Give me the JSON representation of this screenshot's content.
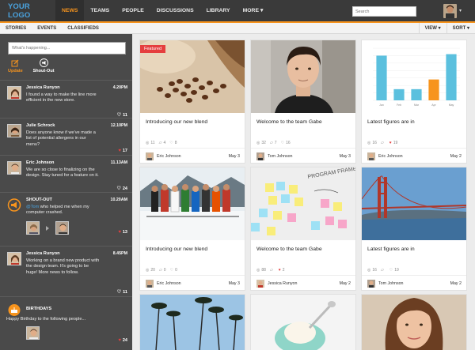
{
  "nav": {
    "logo": "YOUR LOGO",
    "items": [
      {
        "label": "NEWS",
        "active": true
      },
      {
        "label": "TEAMS"
      },
      {
        "label": "PEOPLE"
      },
      {
        "label": "DISCUSSIONS"
      },
      {
        "label": "LIBRARY"
      },
      {
        "label": "MORE ▾"
      }
    ],
    "search_placeholder": "Search",
    "caret": "▾"
  },
  "subnav": {
    "left": [
      "STORIES",
      "EVENTS",
      "CLASSIFIEDS"
    ],
    "view": "VIEW ▾",
    "sort": "SORT ▾"
  },
  "sidebar": {
    "input_placeholder": "What's happening...",
    "update_label": "Update",
    "shout_label": "Shout-Out",
    "feed": [
      {
        "name": "Jessica Runyon",
        "time": "4.20PM",
        "msg": "I found a way to make the line more efficient in the new store.",
        "likes": "11",
        "liked": false
      },
      {
        "name": "Julie Schrock",
        "time": "12.10PM",
        "msg": "Does anyone know if we've made a list of potential allergens in our menu?",
        "likes": "17",
        "liked": true
      },
      {
        "name": "Eric Johnson",
        "time": "11.13AM",
        "msg": "We are so close to finalizing on the design. Stay tuned for a feature on it.",
        "likes": "24",
        "liked": false
      },
      {
        "name": "SHOUT-OUT",
        "time": "10.20AM",
        "msg_pre": "",
        "msg_link": "@Tom",
        "msg_post": " who helped me when my computer crashed.",
        "likes": "13",
        "liked": true
      },
      {
        "name": "Jessica Runyon",
        "time": "8.45PM",
        "msg": "Working on a brand new product with the design team. It's going to be huge! More news to follow.",
        "likes": "11",
        "liked": false
      },
      {
        "name": "BIRTHDAYS",
        "time": "",
        "msg": "Happy Birthday to the following people...",
        "likes": "24",
        "liked": true
      }
    ]
  },
  "cards": [
    {
      "title": "Introducing our new blend",
      "featured": "Featured",
      "views": "11",
      "comments": "4",
      "likes": "8",
      "liked": false,
      "author": "Eric Johnson",
      "date": "May 3"
    },
    {
      "title": "Welcome to the team Gabe",
      "views": "32",
      "comments": "7",
      "likes": "16",
      "liked": false,
      "author": "Tom Johnson",
      "date": "May 3"
    },
    {
      "title": "Latest figures are in",
      "views": "16",
      "comments": "",
      "likes": "19",
      "liked": true,
      "author": "Eric Johnson",
      "date": "May 2"
    },
    {
      "title": "Introducing our new blend",
      "views": "20",
      "comments": "0",
      "likes": "0",
      "liked": false,
      "author": "Eric Johnson",
      "date": "May 3"
    },
    {
      "title": "Welcome to the team Gabe",
      "views": "88",
      "comments": "",
      "likes": "2",
      "liked": true,
      "author": "Jessica Runyon",
      "date": "May 2"
    },
    {
      "title": "Latest figures are in",
      "views": "16",
      "comments": "",
      "likes": "19",
      "liked": false,
      "author": "Tom Johnson",
      "date": "May 2"
    }
  ],
  "mini_chart": {
    "categories": [
      "Jan",
      "Feb",
      "Mar",
      "Apr",
      "May"
    ],
    "values": [
      60,
      15,
      15,
      28,
      62
    ],
    "highlight_index": 3,
    "colors": {
      "bar": "#5bc0de",
      "highlight": "#f7941d"
    }
  },
  "whiteboard_text": "PROGRAM FRAMEW...",
  "colors": {
    "accent": "#f7941d",
    "link": "#4aa3df",
    "nav_bg": "#3a3a3a",
    "sidebar_bg": "#4a4a4a",
    "like": "#e53e3e"
  }
}
